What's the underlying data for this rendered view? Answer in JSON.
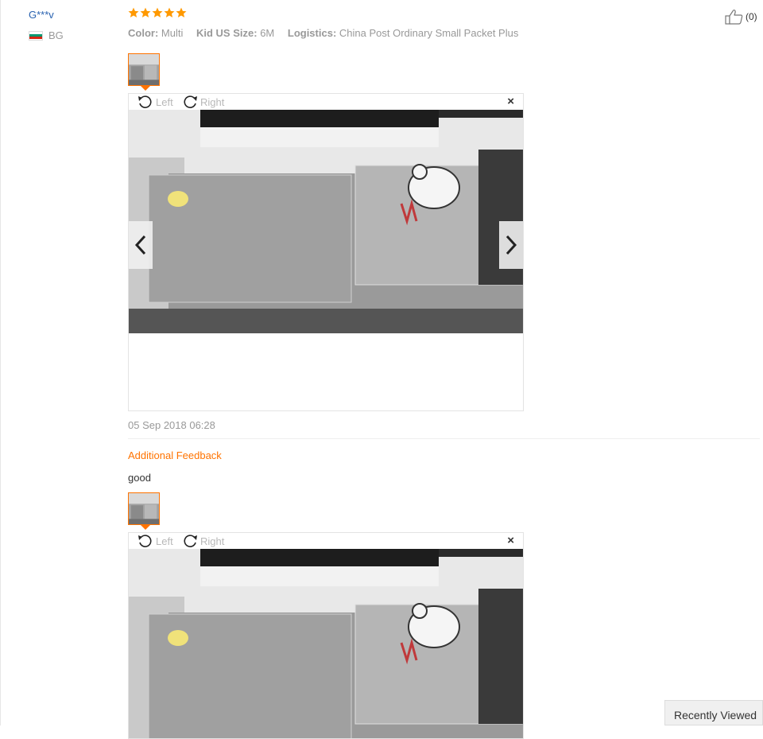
{
  "review": {
    "user": "G***v",
    "country_code": "BG",
    "flag_colors": [
      "#ffffff",
      "#00966e",
      "#d62612"
    ],
    "rating": 5,
    "star_color": "#ff9900",
    "attributes": [
      {
        "key": "Color:",
        "value": "Multi"
      },
      {
        "key": "Kid US Size:",
        "value": "6M"
      },
      {
        "key": "Logistics:",
        "value": "China Post Ordinary Small Packet Plus"
      }
    ],
    "likes": "(0)",
    "date": "05 Sep 2018 06:28"
  },
  "viewer": {
    "rotate_left": "Left",
    "rotate_right": "Right",
    "close": "×"
  },
  "additional_feedback": {
    "title": "Additional Feedback",
    "text": "good"
  },
  "recently_viewed": "Recently Viewed",
  "colors": {
    "accent": "#ff7300",
    "link": "#2962b0",
    "muted": "#999999"
  }
}
